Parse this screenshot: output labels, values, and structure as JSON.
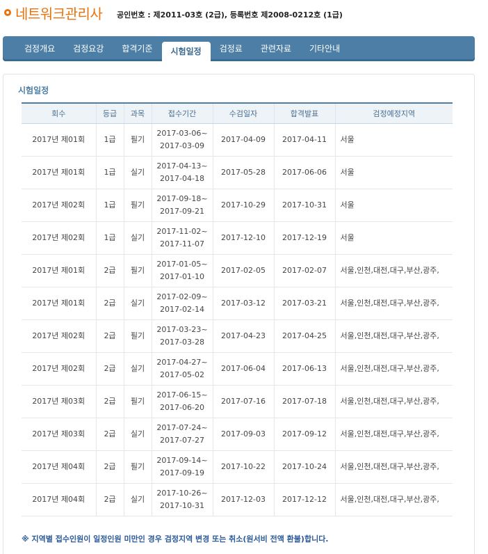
{
  "header": {
    "site_title": "네트워크관리사",
    "cert_info": "공인번호 : 제2011-03호 (2급), 등록번호 제2008-0212호 (1급)"
  },
  "nav": {
    "items": [
      "검정개요",
      "검정요강",
      "합격기준",
      "시험일정",
      "검정료",
      "관련자료",
      "기타안내"
    ],
    "active_index": 3
  },
  "section": {
    "title": "시험일정"
  },
  "table": {
    "headers": [
      "회수",
      "등급",
      "과목",
      "접수기간",
      "수검일자",
      "합격발표",
      "검정예정지역"
    ],
    "rows": [
      {
        "round": "2017년 제01회",
        "grade": "1급",
        "subject": "필기",
        "reg_start": "2017-03-06~",
        "reg_end": "2017-03-09",
        "exam_date": "2017-04-09",
        "result_date": "2017-04-11",
        "region": "서울"
      },
      {
        "round": "2017년 제01회",
        "grade": "1급",
        "subject": "실기",
        "reg_start": "2017-04-13~",
        "reg_end": "2017-04-18",
        "exam_date": "2017-05-28",
        "result_date": "2017-06-06",
        "region": "서울"
      },
      {
        "round": "2017년 제02회",
        "grade": "1급",
        "subject": "필기",
        "reg_start": "2017-09-18~",
        "reg_end": "2017-09-21",
        "exam_date": "2017-10-29",
        "result_date": "2017-10-31",
        "region": "서울"
      },
      {
        "round": "2017년 제02회",
        "grade": "1급",
        "subject": "실기",
        "reg_start": "2017-11-02~",
        "reg_end": "2017-11-07",
        "exam_date": "2017-12-10",
        "result_date": "2017-12-19",
        "region": "서울"
      },
      {
        "round": "2017년 제01회",
        "grade": "2급",
        "subject": "필기",
        "reg_start": "2017-01-05~",
        "reg_end": "2017-01-10",
        "exam_date": "2017-02-05",
        "result_date": "2017-02-07",
        "region": "서울,인천,대전,대구,부산,광주,"
      },
      {
        "round": "2017년 제01회",
        "grade": "2급",
        "subject": "실기",
        "reg_start": "2017-02-09~",
        "reg_end": "2017-02-14",
        "exam_date": "2017-03-12",
        "result_date": "2017-03-21",
        "region": "서울,인천,대전,대구,부산,광주,"
      },
      {
        "round": "2017년 제02회",
        "grade": "2급",
        "subject": "필기",
        "reg_start": "2017-03-23~",
        "reg_end": "2017-03-28",
        "exam_date": "2017-04-23",
        "result_date": "2017-04-25",
        "region": "서울,인천,대전,대구,부산,광주,"
      },
      {
        "round": "2017년 제02회",
        "grade": "2급",
        "subject": "실기",
        "reg_start": "2017-04-27~",
        "reg_end": "2017-05-02",
        "exam_date": "2017-06-04",
        "result_date": "2017-06-13",
        "region": "서울,인천,대전,대구,부산,광주,"
      },
      {
        "round": "2017년 제03회",
        "grade": "2급",
        "subject": "필기",
        "reg_start": "2017-06-15~",
        "reg_end": "2017-06-20",
        "exam_date": "2017-07-16",
        "result_date": "2017-07-18",
        "region": "서울,인천,대전,대구,부산,광주,"
      },
      {
        "round": "2017년 제03회",
        "grade": "2급",
        "subject": "실기",
        "reg_start": "2017-07-24~",
        "reg_end": "2017-07-27",
        "exam_date": "2017-09-03",
        "result_date": "2017-09-12",
        "region": "서울,인천,대전,대구,부산,광주,"
      },
      {
        "round": "2017년 제04회",
        "grade": "2급",
        "subject": "필기",
        "reg_start": "2017-09-14~",
        "reg_end": "2017-09-19",
        "exam_date": "2017-10-22",
        "result_date": "2017-10-24",
        "region": "서울,인천,대전,대구,부산,광주,"
      },
      {
        "round": "2017년 제04회",
        "grade": "2급",
        "subject": "실기",
        "reg_start": "2017-10-26~",
        "reg_end": "2017-10-31",
        "exam_date": "2017-12-03",
        "result_date": "2017-12-12",
        "region": "서울,인천,대전,대구,부산,광주,"
      }
    ]
  },
  "notice": "※ 지역별 접수인원이 일정인원 미만인 경우 검정지역 변경 또는 취소(원서비 전액 환불)합니다."
}
